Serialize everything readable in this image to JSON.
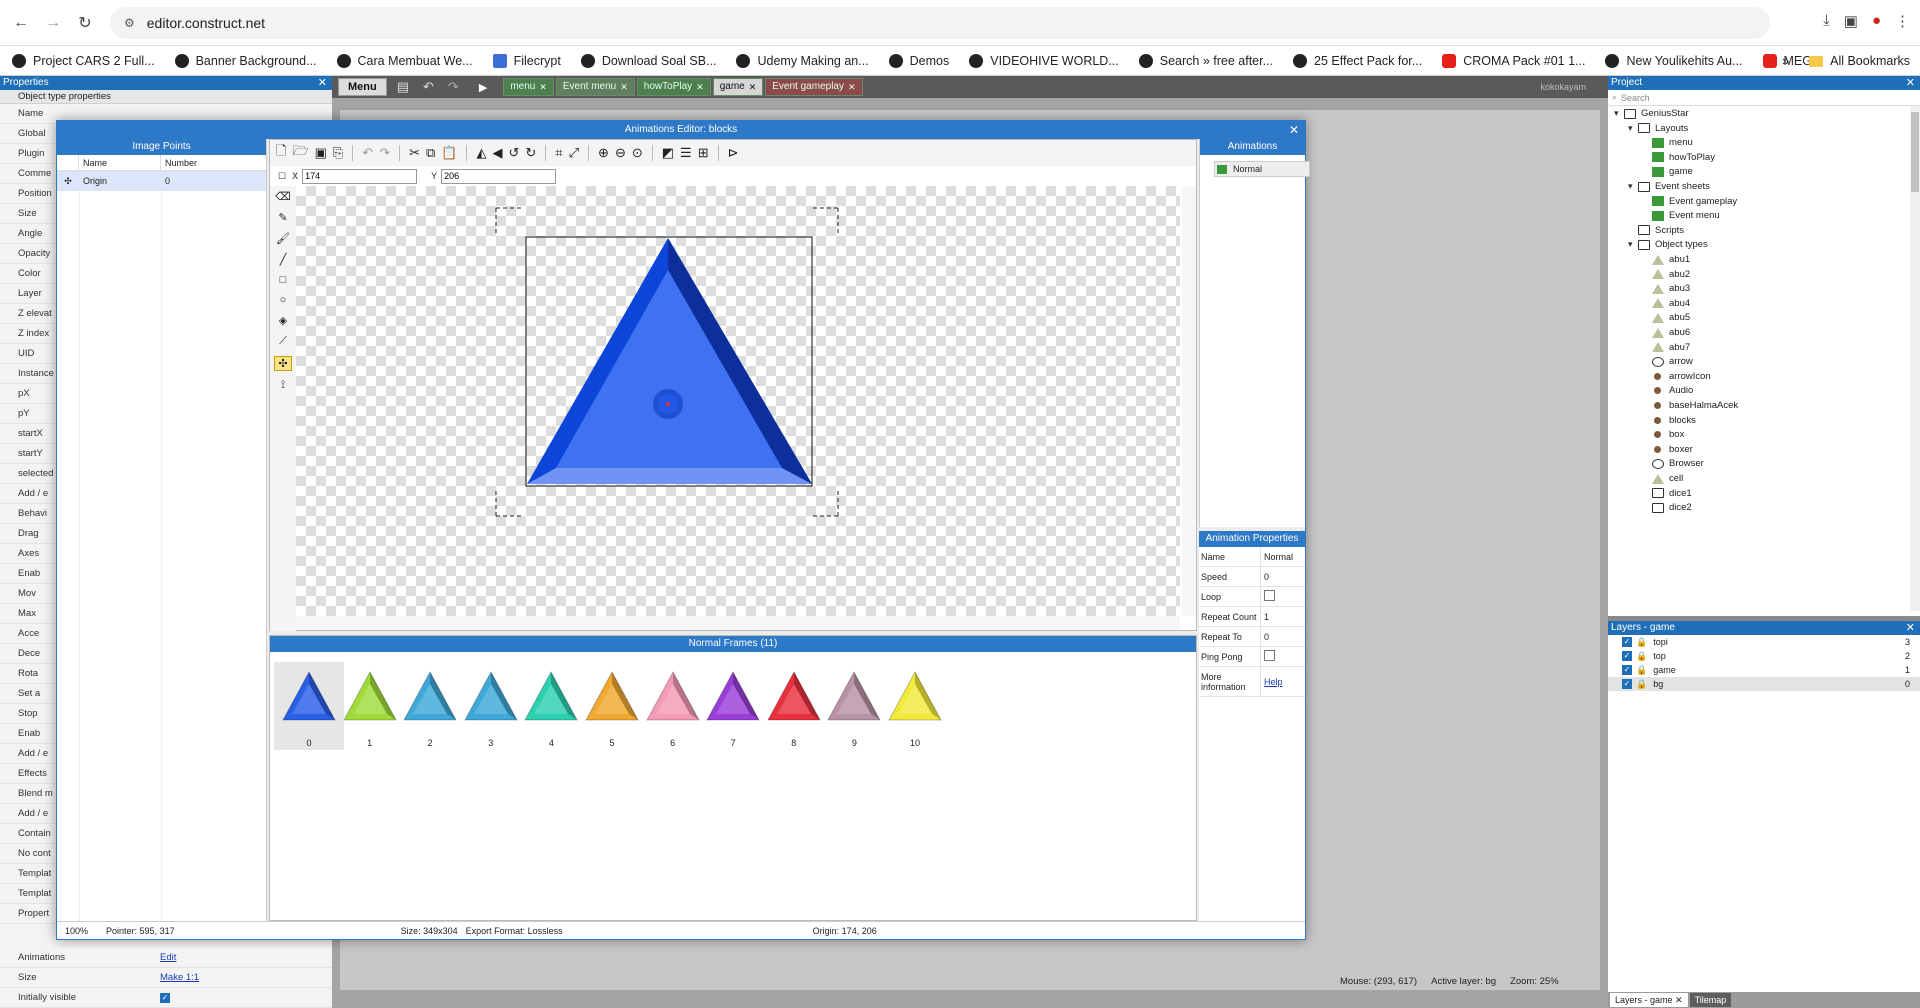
{
  "browser": {
    "url": "editor.construct.net",
    "bookmarks": [
      "Project CARS 2 Full...",
      "Banner Background...",
      "Cara Membuat We...",
      "Filecrypt",
      "Download Soal SB...",
      "Udemy Making an...",
      "Demos",
      "VIDEOHIVE WORLD...",
      "Search » free after...",
      "25 Effect Pack for...",
      "CROMA Pack #01 1...",
      "New Youlikehits Au...",
      "MEGA"
    ],
    "all_bookmarks": "All Bookmarks"
  },
  "left_panel": {
    "title": "Properties",
    "section": "Object type properties",
    "rows": [
      "Name",
      "Global",
      "Plugin",
      "Comme",
      "Position",
      "Size",
      "Angle",
      "Opacity",
      "Color",
      "Layer",
      "Z elevat",
      "Z index",
      "UID",
      "Instance",
      "pX",
      "pY",
      "startX",
      "startY",
      "selected",
      "Add / e",
      "Behavi",
      "Drag",
      "Axes",
      "Enab",
      "Mov",
      "Max",
      "Acce",
      "Dece",
      "Rota",
      "Set a",
      "Stop",
      "Enab",
      "Add / e",
      "Effects",
      "Blend m",
      "Add / e",
      "Contain",
      "No cont",
      "Templat",
      "Templat",
      "Propert"
    ],
    "bottom_rows": [
      {
        "label": "Animations",
        "value": "Edit"
      },
      {
        "label": "Size",
        "value": "Make 1:1"
      },
      {
        "label": "Initially visible",
        "value": ""
      }
    ]
  },
  "menubar": {
    "menu_label": "Menu",
    "tabs": [
      {
        "label": "menu",
        "kind": "layout"
      },
      {
        "label": "Event menu",
        "kind": "event"
      },
      {
        "label": "howToPlay",
        "kind": "layout"
      },
      {
        "label": "game",
        "kind": "active"
      },
      {
        "label": "Event gameplay",
        "kind": "red"
      }
    ],
    "user": "kokokayam"
  },
  "modal": {
    "title": "Animations Editor: blocks",
    "image_points": {
      "title": "Image Points",
      "col_name": "Name",
      "col_number": "Number",
      "rows": [
        {
          "name": "Origin",
          "number": "0"
        }
      ]
    },
    "x_label": "X",
    "x_value": "174",
    "y_label": "Y",
    "y_value": "206",
    "animations": {
      "title": "Animations",
      "items": [
        "Normal"
      ]
    },
    "animation_properties": {
      "title": "Animation Properties",
      "rows": [
        {
          "k": "Name",
          "v": "Normal"
        },
        {
          "k": "Speed",
          "v": "0"
        },
        {
          "k": "Loop",
          "v": ""
        },
        {
          "k": "Repeat Count",
          "v": "1"
        },
        {
          "k": "Repeat To",
          "v": "0"
        },
        {
          "k": "Ping Pong",
          "v": ""
        },
        {
          "k": "More information",
          "v": "Help"
        }
      ]
    },
    "frames": {
      "title": "Normal Frames (11)",
      "items": [
        {
          "label": "0",
          "color": "#2a5fe8"
        },
        {
          "label": "1",
          "color": "#9fdc3a"
        },
        {
          "label": "2",
          "color": "#3ea9d8"
        },
        {
          "label": "3",
          "color": "#3ea9d8"
        },
        {
          "label": "4",
          "color": "#2cd0b0"
        },
        {
          "label": "5",
          "color": "#f0a830"
        },
        {
          "label": "6",
          "color": "#f39ab4"
        },
        {
          "label": "7",
          "color": "#9a3ed8"
        },
        {
          "label": "8",
          "color": "#e8303f"
        },
        {
          "label": "9",
          "color": "#b893a4"
        },
        {
          "label": "10",
          "color": "#f2ea3a"
        }
      ]
    },
    "status": {
      "zoom": "100%",
      "pointer": "Pointer: 595, 317",
      "size": "Size: 349x304",
      "export": "Export Format: Lossless",
      "origin": "Origin: 174, 206"
    }
  },
  "project": {
    "title": "Project",
    "search_placeholder": "Search",
    "tree": [
      {
        "label": "GeniusStar",
        "depth": 0,
        "icon": "folder",
        "tw": "▾"
      },
      {
        "label": "Layouts",
        "depth": 1,
        "icon": "folder",
        "tw": "▾"
      },
      {
        "label": "menu",
        "depth": 2,
        "icon": "layout"
      },
      {
        "label": "howToPlay",
        "depth": 2,
        "icon": "layout"
      },
      {
        "label": "game",
        "depth": 2,
        "icon": "layout"
      },
      {
        "label": "Event sheets",
        "depth": 1,
        "icon": "folder",
        "tw": "▾"
      },
      {
        "label": "Event gameplay",
        "depth": 2,
        "icon": "layout"
      },
      {
        "label": "Event menu",
        "depth": 2,
        "icon": "layout"
      },
      {
        "label": "Scripts",
        "depth": 1,
        "icon": "folder",
        "tw": ""
      },
      {
        "label": "Object types",
        "depth": 1,
        "icon": "folder",
        "tw": "▾"
      },
      {
        "label": "abu1",
        "depth": 2,
        "icon": "tri"
      },
      {
        "label": "abu2",
        "depth": 2,
        "icon": "tri"
      },
      {
        "label": "abu3",
        "depth": 2,
        "icon": "tri"
      },
      {
        "label": "abu4",
        "depth": 2,
        "icon": "tri"
      },
      {
        "label": "abu5",
        "depth": 2,
        "icon": "tri"
      },
      {
        "label": "abu6",
        "depth": 2,
        "icon": "tri"
      },
      {
        "label": "abu7",
        "depth": 2,
        "icon": "tri"
      },
      {
        "label": "arrow",
        "depth": 2,
        "icon": "circ"
      },
      {
        "label": "arrowIcon",
        "depth": 2,
        "icon": "dot"
      },
      {
        "label": "Audio",
        "depth": 2,
        "icon": "dot"
      },
      {
        "label": "baseHalmaAcek",
        "depth": 2,
        "icon": "dot"
      },
      {
        "label": "blocks",
        "depth": 2,
        "icon": "dot"
      },
      {
        "label": "box",
        "depth": 2,
        "icon": "dot"
      },
      {
        "label": "boxer",
        "depth": 2,
        "icon": "dot"
      },
      {
        "label": "Browser",
        "depth": 2,
        "icon": "circ"
      },
      {
        "label": "cell",
        "depth": 2,
        "icon": "tri"
      },
      {
        "label": "dice1",
        "depth": 2,
        "icon": "fold"
      },
      {
        "label": "dice2",
        "depth": 2,
        "icon": "fold"
      }
    ]
  },
  "layers": {
    "title": "Layers - game",
    "items": [
      {
        "name": "topi",
        "num": "3"
      },
      {
        "name": "top",
        "num": "2"
      },
      {
        "name": "game",
        "num": "1"
      },
      {
        "name": "bg",
        "num": "0"
      }
    ],
    "tab_active": "Layers - game",
    "tab_other": "Tilemap"
  },
  "app_status": {
    "mouse": "Mouse: (293, 617)",
    "active_layer": "Active layer: bg",
    "zoom": "Zoom: 25%"
  }
}
